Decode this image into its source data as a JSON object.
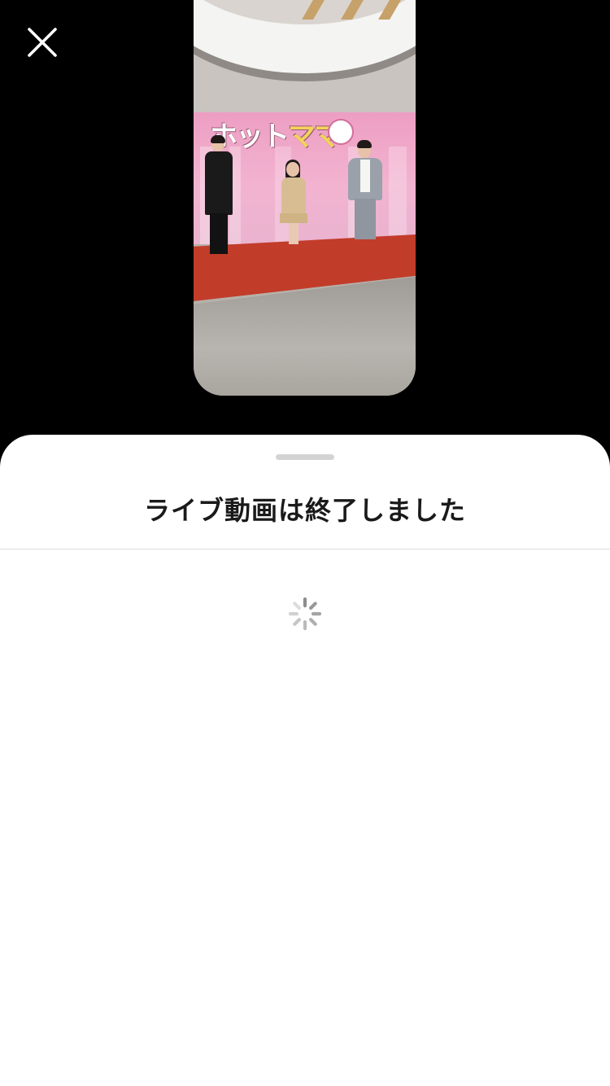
{
  "icons": {
    "close": "close-icon",
    "spinner": "loading-spinner-icon"
  },
  "preview": {
    "logo_main": "ホット",
    "logo_accent": "ママ"
  },
  "sheet": {
    "title": "ライブ動画は終了しました",
    "loading": true
  },
  "colors": {
    "background": "#000000",
    "sheet": "#ffffff",
    "title": "#1a1a1a",
    "divider": "#dbdbdb",
    "grabber": "#d3d3d3",
    "spinner": "#8e8e8e"
  }
}
